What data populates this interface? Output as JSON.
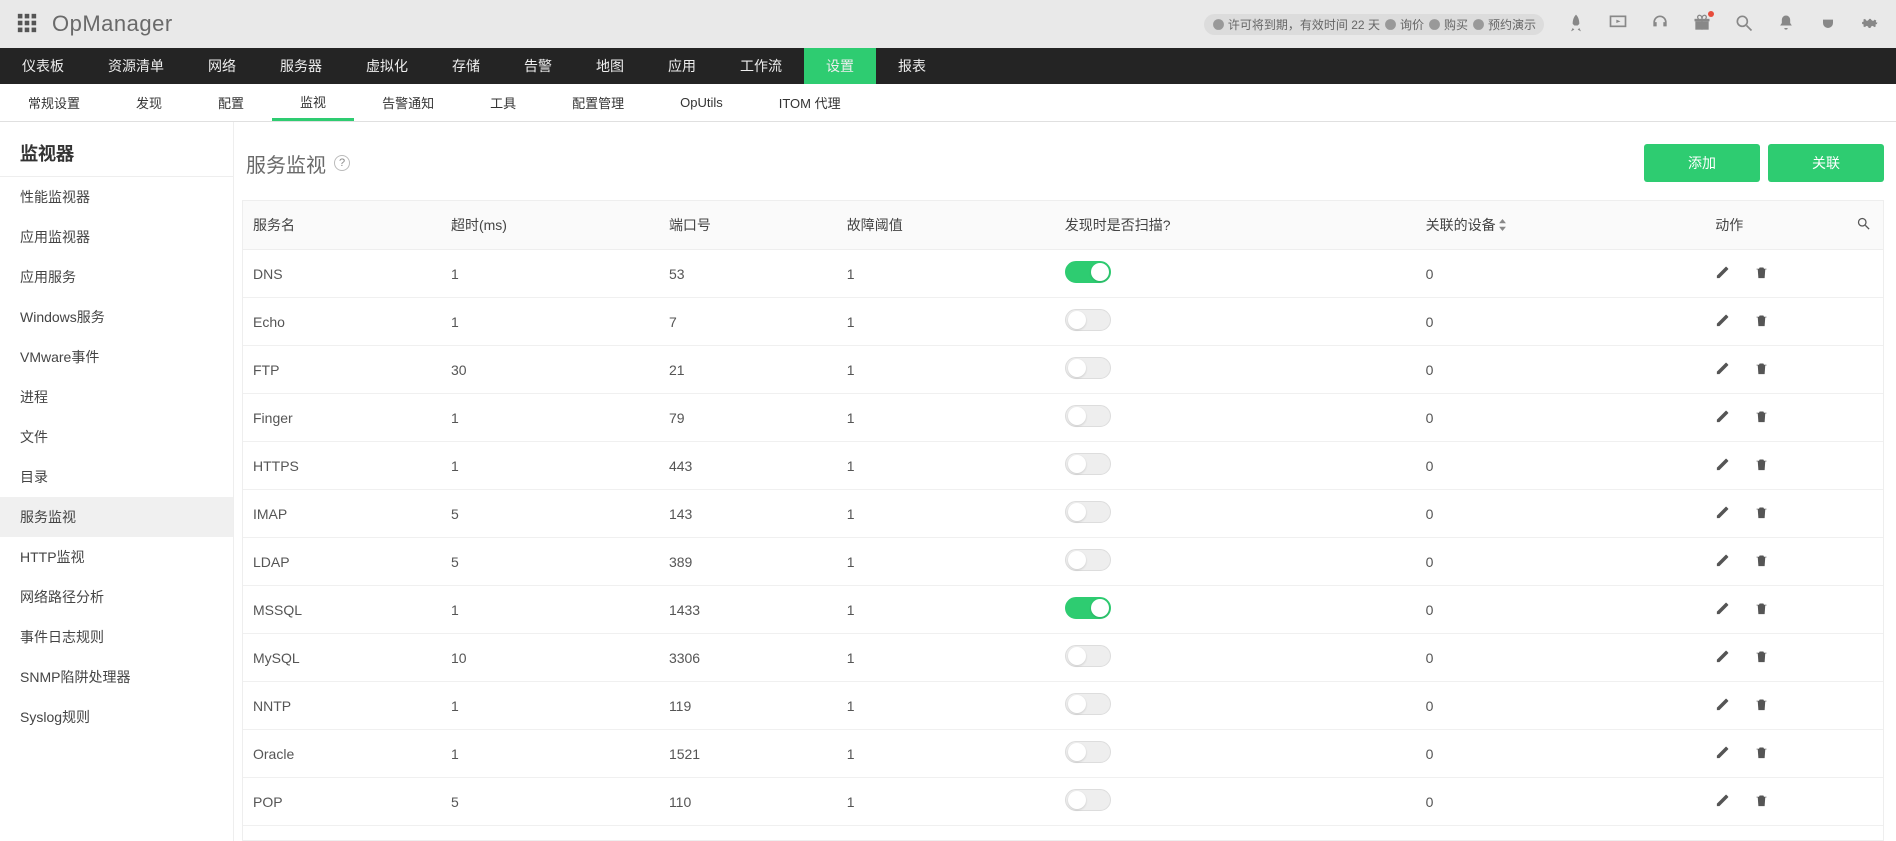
{
  "brand": "OpManager",
  "topbar": {
    "license": "许可将到期，有效时间 22 天",
    "quote": "询价",
    "buy": "购买",
    "demo": "预约演示"
  },
  "mainnav": [
    "仪表板",
    "资源清单",
    "网络",
    "服务器",
    "虚拟化",
    "存储",
    "告警",
    "地图",
    "应用",
    "工作流",
    "设置",
    "报表"
  ],
  "mainnav_active": 10,
  "subnav": [
    "常规设置",
    "发现",
    "配置",
    "监视",
    "告警通知",
    "工具",
    "配置管理",
    "OpUtils",
    "ITOM 代理"
  ],
  "subnav_active": 3,
  "sidebar": {
    "title": "监视器",
    "items": [
      "性能监视器",
      "应用监视器",
      "应用服务",
      "Windows服务",
      "VMware事件",
      "进程",
      "文件",
      "目录",
      "服务监视",
      "HTTP监视",
      "网络路径分析",
      "事件日志规则",
      "SNMP陷阱处理器",
      "Syslog规则"
    ],
    "active": 8
  },
  "page": {
    "title": "服务监视",
    "add": "添加",
    "link": "关联"
  },
  "table": {
    "cols": [
      "服务名",
      "超时(ms)",
      "端口号",
      "故障阈值",
      "发现时是否扫描?",
      "关联的设备",
      "动作"
    ],
    "rows": [
      {
        "name": "DNS",
        "timeout": "1",
        "port": "53",
        "threshold": "1",
        "scan": true,
        "devices": "0"
      },
      {
        "name": "Echo",
        "timeout": "1",
        "port": "7",
        "threshold": "1",
        "scan": false,
        "devices": "0"
      },
      {
        "name": "FTP",
        "timeout": "30",
        "port": "21",
        "threshold": "1",
        "scan": false,
        "devices": "0"
      },
      {
        "name": "Finger",
        "timeout": "1",
        "port": "79",
        "threshold": "1",
        "scan": false,
        "devices": "0"
      },
      {
        "name": "HTTPS",
        "timeout": "1",
        "port": "443",
        "threshold": "1",
        "scan": false,
        "devices": "0"
      },
      {
        "name": "IMAP",
        "timeout": "5",
        "port": "143",
        "threshold": "1",
        "scan": false,
        "devices": "0"
      },
      {
        "name": "LDAP",
        "timeout": "5",
        "port": "389",
        "threshold": "1",
        "scan": false,
        "devices": "0"
      },
      {
        "name": "MSSQL",
        "timeout": "1",
        "port": "1433",
        "threshold": "1",
        "scan": true,
        "devices": "0"
      },
      {
        "name": "MySQL",
        "timeout": "10",
        "port": "3306",
        "threshold": "1",
        "scan": false,
        "devices": "0"
      },
      {
        "name": "NNTP",
        "timeout": "1",
        "port": "119",
        "threshold": "1",
        "scan": false,
        "devices": "0"
      },
      {
        "name": "Oracle",
        "timeout": "1",
        "port": "1521",
        "threshold": "1",
        "scan": false,
        "devices": "0"
      },
      {
        "name": "POP",
        "timeout": "5",
        "port": "110",
        "threshold": "1",
        "scan": false,
        "devices": "0"
      }
    ]
  }
}
